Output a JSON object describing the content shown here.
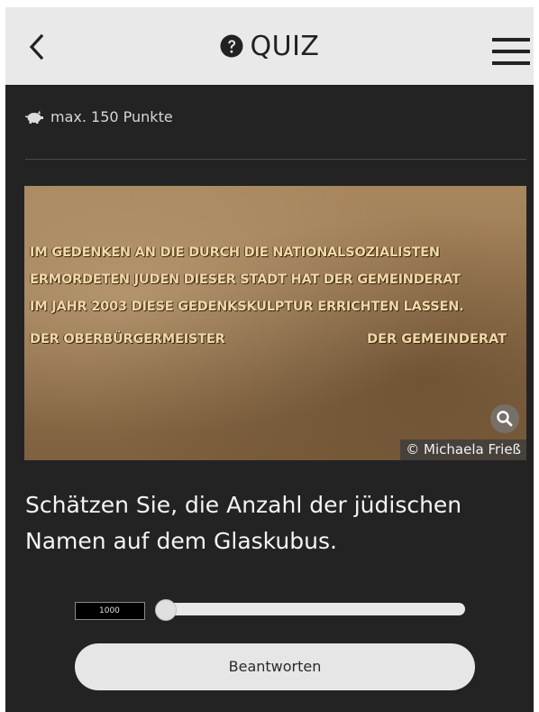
{
  "header": {
    "title": "QUIZ",
    "back_icon": "chevron-left-icon",
    "title_icon": "question-circle-icon",
    "menu_icon": "hamburger-menu-icon"
  },
  "points": {
    "icon": "piggy-bank-icon",
    "label": "max. 150 Punkte"
  },
  "image": {
    "lines": [
      "IM GEDENKEN AN DIE DURCH DIE NATIONALSOZIALISTEN",
      "ERMORDETEN JUDEN DIESER STADT HAT DER GEMEINDERAT",
      "IM JAHR 2003 DIESE GEDENKSKULPTUR ERRICHTEN LASSEN.",
      "DER OBERBÜRGERMEISTER"
    ],
    "line_right": "DER GEMEINDERAT",
    "credit": "© Michaela Frieß",
    "zoom_icon": "magnifier-icon"
  },
  "question": {
    "text": "Schätzen Sie, die Anzahl der jüdischen Namen auf dem Glaskubus."
  },
  "slider": {
    "value": "1000",
    "position_fraction": 0
  },
  "answer_button": {
    "label": "Beantworten"
  },
  "colors": {
    "background": "#232323",
    "header": "#e9e9e9",
    "button": "#e6e6e6"
  }
}
